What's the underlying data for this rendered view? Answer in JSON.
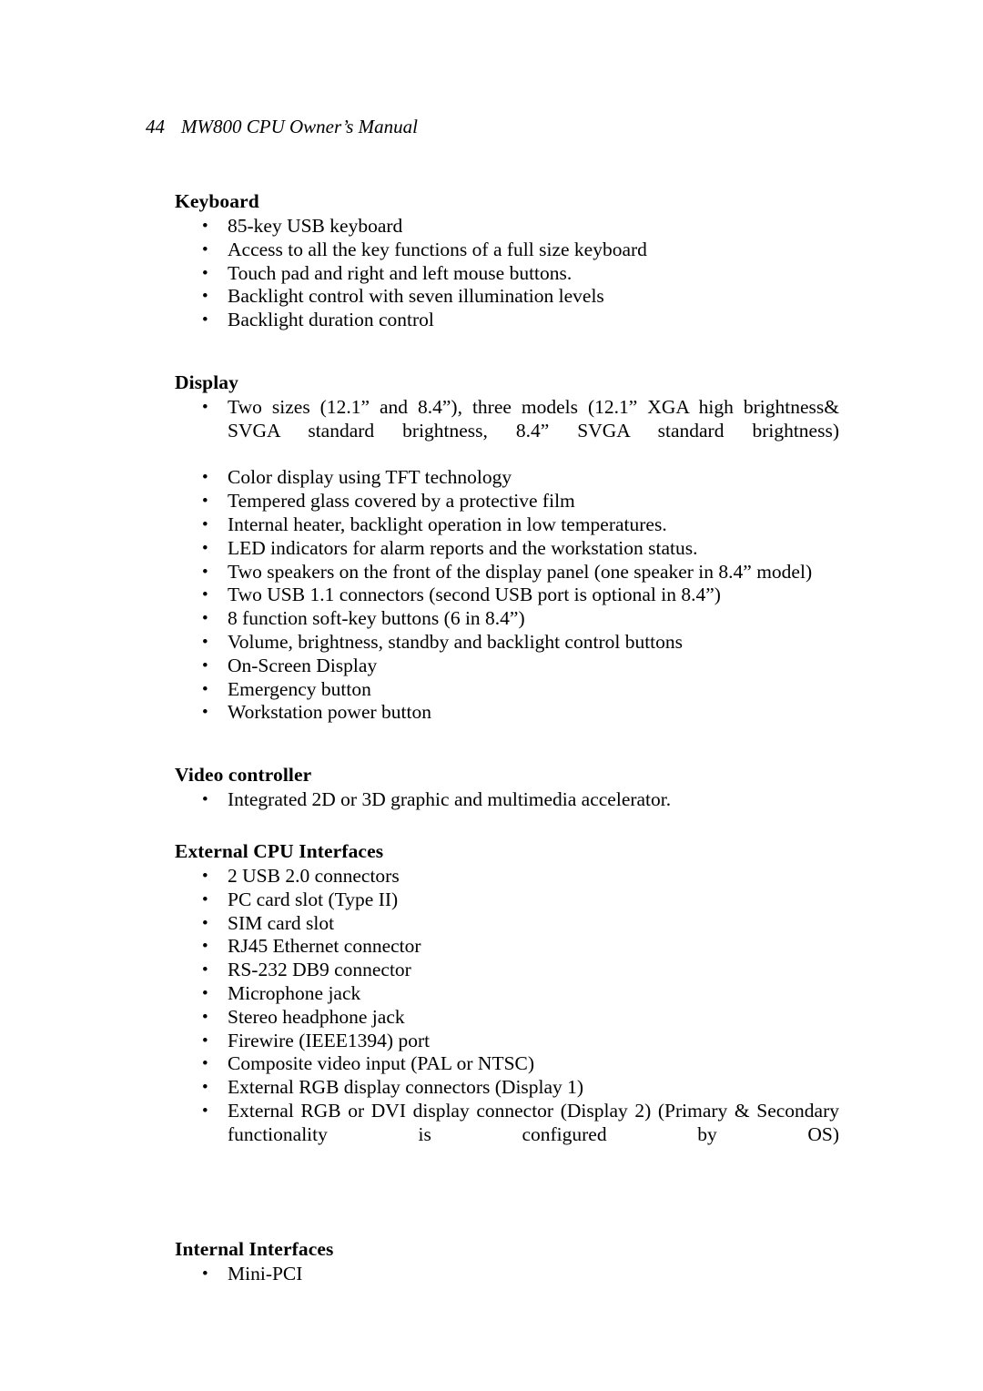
{
  "document": {
    "header": {
      "page_number": "44",
      "title": "MW800 CPU Owner’s Manual"
    },
    "sections": [
      {
        "heading": "Keyboard",
        "bullets": [
          "85-key USB keyboard",
          "Access to all the key functions of a full size keyboard",
          "Touch pad and right and left mouse buttons.",
          "Backlight control with seven illumination levels",
          "Backlight duration control"
        ]
      },
      {
        "heading": "Display",
        "bullets": [
          "Two sizes (12.1” and 8.4”), three models (12.1” XGA high brightness& SVGA standard brightness, 8.4” SVGA standard brightness)",
          "Color display using TFT technology",
          "Tempered glass covered by a protective film",
          "Internal heater, backlight operation in low temperatures.",
          "LED indicators for alarm reports and the workstation status.",
          "Two speakers on the front of the display panel (one speaker in 8.4” model)",
          "Two USB 1.1 connectors (second USB port is optional in 8.4”)",
          "8 function soft-key buttons (6 in 8.4”)",
          "Volume, brightness, standby and backlight control buttons",
          "On-Screen Display",
          "Emergency button",
          "Workstation power button"
        ]
      },
      {
        "heading": "Video controller",
        "bullets": [
          "Integrated 2D or 3D graphic and multimedia accelerator."
        ]
      },
      {
        "heading": "External CPU Interfaces",
        "bullets": [
          "2 USB 2.0 connectors",
          "PC card slot (Type II)",
          "SIM card slot",
          "RJ45 Ethernet connector",
          "RS-232 DB9 connector",
          "Microphone jack",
          "Stereo headphone jack",
          "Firewire (IEEE1394) port",
          "Composite video input (PAL or NTSC)",
          "External RGB display connectors (Display 1)",
          "External RGB or DVI display connector (Display 2) (Primary & Secondary functionality is configured by OS)"
        ]
      },
      {
        "heading": "Internal Interfaces",
        "bullets": [
          "Mini-PCI"
        ]
      }
    ]
  }
}
